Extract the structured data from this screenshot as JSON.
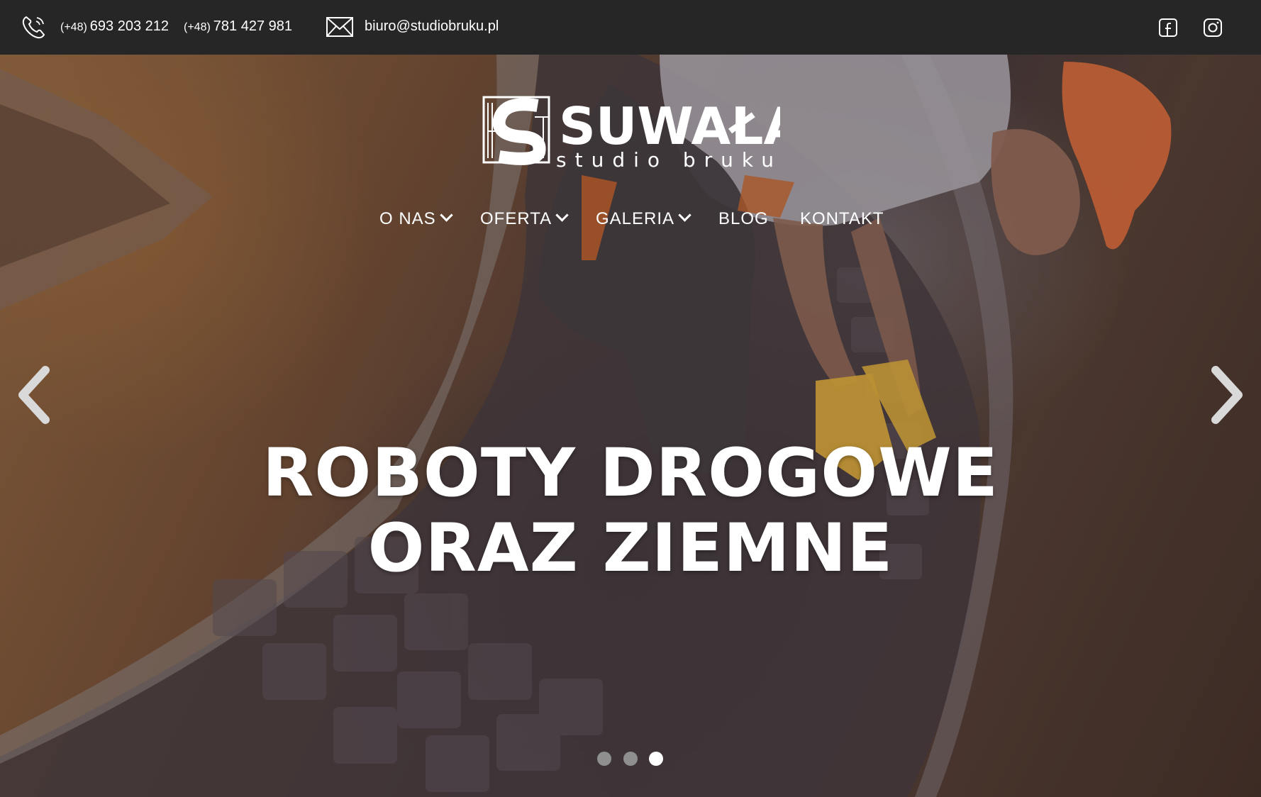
{
  "topbar": {
    "phones": [
      {
        "prefix": "(+48)",
        "number": "693 203 212"
      },
      {
        "prefix": "(+48)",
        "number": "781 427 981"
      }
    ],
    "email": "biuro@studiobruku.pl",
    "icons": [
      "phone-icon",
      "mail-icon",
      "facebook-icon",
      "instagram-icon"
    ]
  },
  "logo": {
    "name": "SUWAŁA",
    "tagline": "studio bruku"
  },
  "nav": {
    "items": [
      {
        "label": "O NAS",
        "dropdown": true
      },
      {
        "label": "OFERTA",
        "dropdown": true
      },
      {
        "label": "GALERIA",
        "dropdown": true
      },
      {
        "label": "BLOG",
        "dropdown": false
      },
      {
        "label": "KONTAKT",
        "dropdown": false
      }
    ]
  },
  "hero": {
    "headline_line1": "ROBOTY DROGOWE",
    "headline_line2": "ORAZ ZIEMNE",
    "slides_total": 3,
    "active_slide": 3
  },
  "colors": {
    "topbar": "#262626",
    "text": "#ffffff",
    "dot_inactive": "#8f8f8f",
    "dot_active": "#ffffff"
  }
}
